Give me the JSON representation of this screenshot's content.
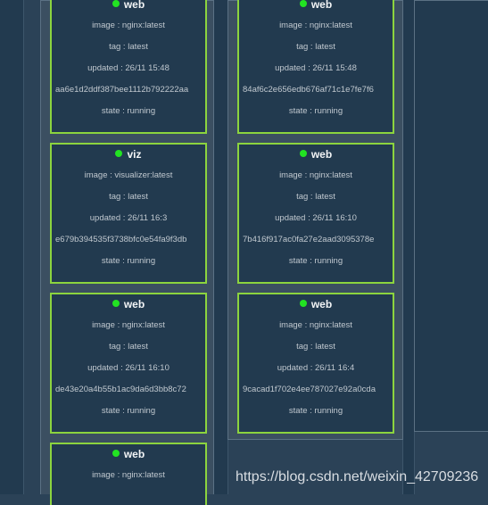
{
  "cluster": {
    "nodes": [
      {
        "tasks": [
          {
            "name": "web",
            "image": "image : nginx:latest",
            "tag": "tag : latest",
            "updated": "updated : 26/11 15:48",
            "id": "aa6e1d2ddf387bee1112b792222aa",
            "state": "state : running"
          },
          {
            "name": "viz",
            "image": "image : visualizer:latest",
            "tag": "tag : latest",
            "updated": "updated : 26/11 16:3",
            "id": "e679b394535f3738bfc0e54fa9f3db",
            "state": "state : running"
          },
          {
            "name": "web",
            "image": "image : nginx:latest",
            "tag": "tag : latest",
            "updated": "updated : 26/11 16:10",
            "id": "de43e20a4b55b1ac9da6d3bb8c72",
            "state": "state : running"
          },
          {
            "name": "web",
            "image": "image : nginx:latest",
            "tag": "",
            "updated": "",
            "id": "",
            "state": ""
          }
        ]
      },
      {
        "tasks": [
          {
            "name": "web",
            "image": "image : nginx:latest",
            "tag": "tag : latest",
            "updated": "updated : 26/11 15:48",
            "id": "84af6c2e656edb676af71c1e7fe7f6",
            "state": "state : running"
          },
          {
            "name": "web",
            "image": "image : nginx:latest",
            "tag": "tag : latest",
            "updated": "updated : 26/11 16:10",
            "id": "7b416f917ac0fa27e2aad3095378e",
            "state": "state : running"
          },
          {
            "name": "web",
            "image": "image : nginx:latest",
            "tag": "tag : latest",
            "updated": "updated : 26/11 16:4",
            "id": "9cacad1f702e4ee787027e92a0cda",
            "state": "state : running"
          }
        ]
      }
    ]
  },
  "watermark": "https://blog.csdn.net/weixin_42709236",
  "colors": {
    "task_border": "#8cd43e",
    "status_dot": "#22e322",
    "background": "#2b4257"
  }
}
